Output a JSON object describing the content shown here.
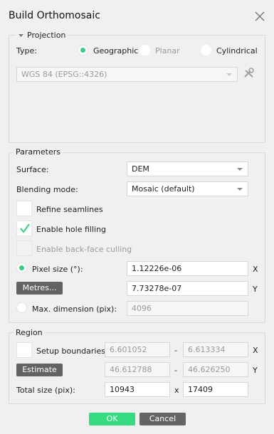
{
  "window": {
    "title": "Build Orthomosaic"
  },
  "projection": {
    "group_title": "Projection",
    "type_label": "Type:",
    "options": [
      "Geographic",
      "Planar",
      "Cylindrical"
    ],
    "selected": "Geographic",
    "crs_value": "WGS 84 (EPSG::4326)"
  },
  "parameters": {
    "group_title": "Parameters",
    "surface_label": "Surface:",
    "surface_value": "DEM",
    "blending_label": "Blending mode:",
    "blending_value": "Mosaic (default)",
    "refine_seamlines_label": "Refine seamlines",
    "refine_seamlines_checked": false,
    "enable_hole_filling_label": "Enable hole filling",
    "enable_hole_filling_checked": true,
    "back_face_culling_label": "Enable back-face culling",
    "back_face_culling_checked": false,
    "pixel_size_label": "Pixel size (°):",
    "pixel_size_x": "1.12226e-06",
    "pixel_size_y": "7.73278e-07",
    "metres_button": "Metres...",
    "max_dimension_label": "Max. dimension (pix):",
    "max_dimension_value": "4096",
    "x_axis": "X",
    "y_axis": "Y"
  },
  "region": {
    "group_title": "Region",
    "setup_boundaries_label": "Setup boundaries:",
    "setup_boundaries_checked": false,
    "x_min": "6.601052",
    "x_max": "6.613334",
    "estimate_button": "Estimate",
    "y_min": "46.612788",
    "y_max": "46.626250",
    "total_size_label": "Total size (pix):",
    "total_x": "10943",
    "total_y": "17409",
    "dash": "-",
    "times": "x",
    "x_axis": "X",
    "y_axis": "Y"
  },
  "buttons": {
    "ok": "OK",
    "cancel": "Cancel"
  },
  "colors": {
    "accent_green": "#34dc7f",
    "radio_green": "#2fd27d",
    "dark_button": "#636363"
  }
}
